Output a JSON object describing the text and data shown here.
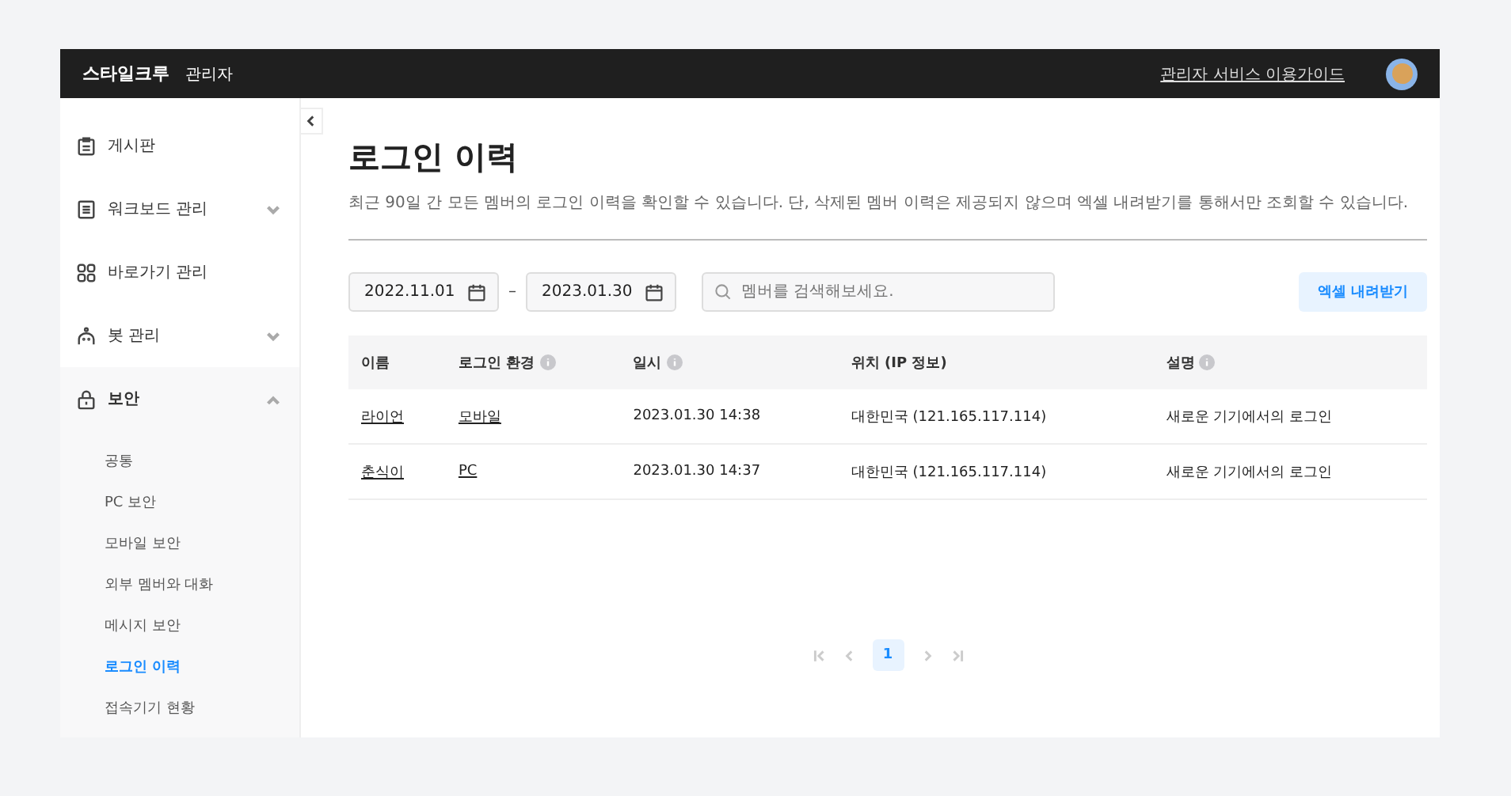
{
  "header": {
    "brand": "스타일크루",
    "role": "관리자",
    "guide_link": "관리자 서비스 이용가이드"
  },
  "sidebar": {
    "items": [
      {
        "label": "게시판",
        "kind": "board"
      },
      {
        "label": "워크보드 관리",
        "kind": "list",
        "expanded": false
      },
      {
        "label": "바로가기 관리",
        "kind": "grid"
      },
      {
        "label": "봇 관리",
        "kind": "bot",
        "expanded": false
      },
      {
        "label": "보안",
        "kind": "lock",
        "expanded": true,
        "children": [
          {
            "label": "공통",
            "selected": false
          },
          {
            "label": "PC 보안",
            "selected": false
          },
          {
            "label": "모바일 보안",
            "selected": false
          },
          {
            "label": "외부 멤버와 대화",
            "selected": false
          },
          {
            "label": "메시지 보안",
            "selected": false
          },
          {
            "label": "로그인 이력",
            "selected": true
          },
          {
            "label": "접속기기 현황",
            "selected": false
          }
        ]
      }
    ]
  },
  "page": {
    "title": "로그인 이력",
    "description": "최근 90일 간 모든 멤버의 로그인 이력을 확인할 수 있습니다. 단, 삭제된 멤버 이력은 제공되지 않으며 엑셀 내려받기를 통해서만 조회할 수 있습니다."
  },
  "filters": {
    "start_date": "2022.11.01",
    "separator": "–",
    "end_date": "2023.01.30",
    "search": {
      "placeholder": "멤버를 검색해보세요."
    },
    "export_button": "엑셀 내려받기"
  },
  "table": {
    "columns": [
      {
        "label": "이름",
        "info": false
      },
      {
        "label": "로그인 환경",
        "info": true
      },
      {
        "label": "일시",
        "info": true
      },
      {
        "label": "위치 (IP 정보)",
        "info": false
      },
      {
        "label": "설명",
        "info": true
      }
    ],
    "rows": [
      [
        "라이언",
        "모바일",
        "2023.01.30 14:38",
        "대한민국 (121.165.117.114)",
        "새로운 기기에서의 로그인"
      ],
      [
        "춘식이",
        "PC",
        "2023.01.30 14:37",
        "대한민국 (121.165.117.114)",
        "새로운 기기에서의 로그인"
      ]
    ]
  },
  "pagination": {
    "pages": [
      {
        "label": "1",
        "selected": true
      }
    ]
  }
}
